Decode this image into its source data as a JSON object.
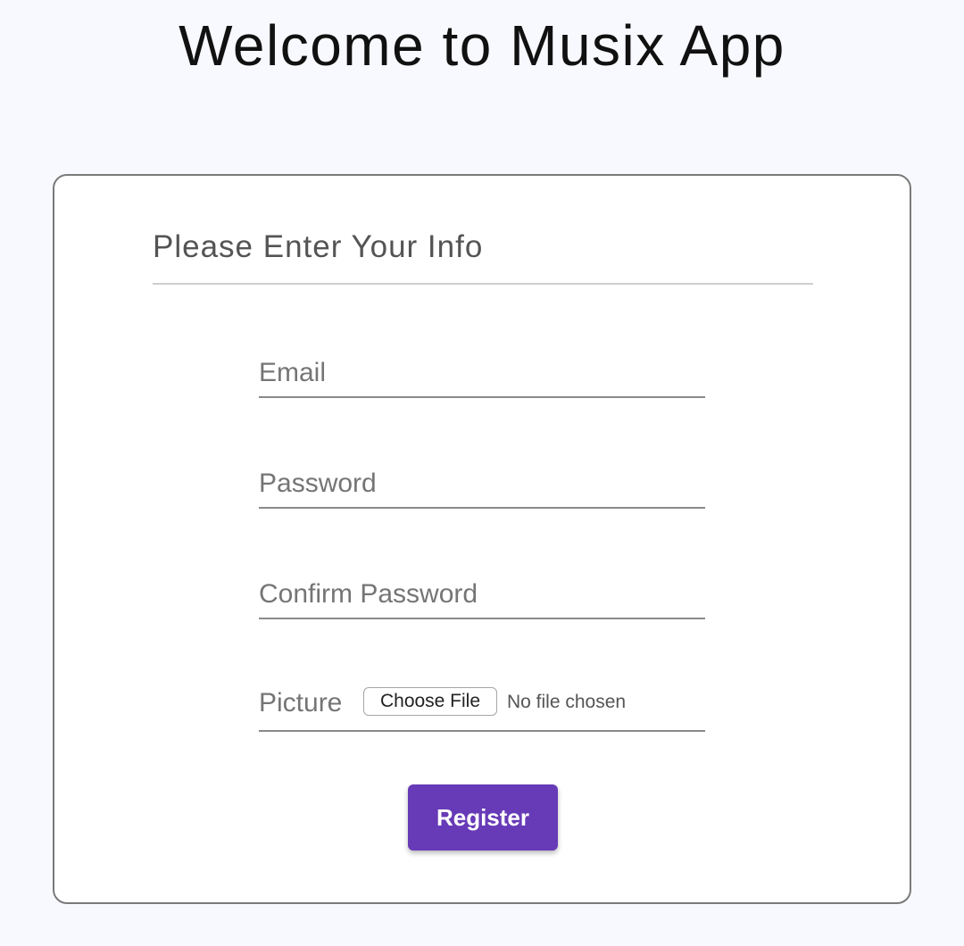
{
  "page": {
    "title": "Welcome to Musix App",
    "background_color": "#f8f9fe"
  },
  "form": {
    "heading": "Please Enter Your Info",
    "email_placeholder": "Email",
    "password_placeholder": "Password",
    "confirm_password_placeholder": "Confirm Password",
    "email_value": "",
    "password_value": "",
    "confirm_password_value": "",
    "picture_label": "Picture",
    "choose_file_label": "Choose File",
    "file_status": "No file chosen",
    "register_label": "Register",
    "accent_color": "#673ab7"
  }
}
